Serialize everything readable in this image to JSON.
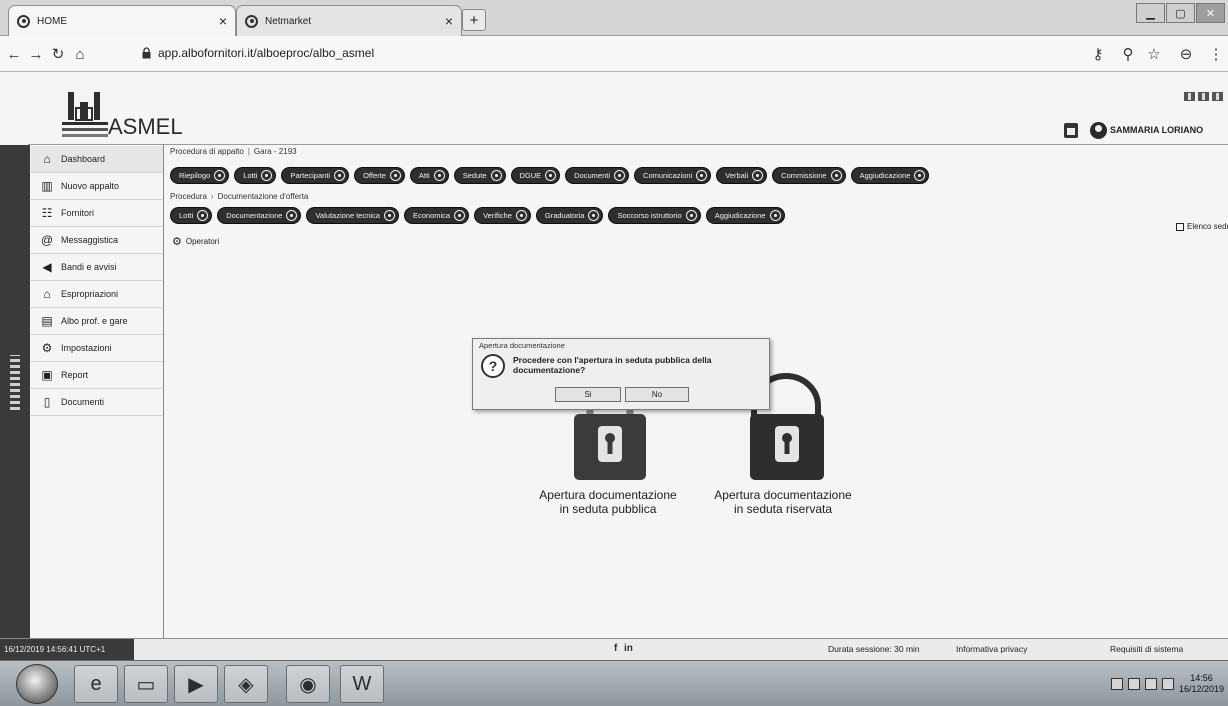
{
  "browser": {
    "tabs": [
      {
        "title": "HOME",
        "icon": "globe-icon"
      },
      {
        "title": "Netmarket",
        "icon": "netmarket-icon"
      }
    ],
    "url": "app.albofornitori.it/alboeproc/albo_asmel"
  },
  "header": {
    "logo_text": "ASMEL",
    "user_name": "SAMMARIA LORIANO"
  },
  "sidebar": {
    "items": [
      {
        "label": "Dashboard",
        "icon": "home-icon"
      },
      {
        "label": "Nuovo appalto",
        "icon": "building-icon"
      },
      {
        "label": "Fornitori",
        "icon": "users-icon"
      },
      {
        "label": "Messaggistica",
        "icon": "at-icon"
      },
      {
        "label": "Bandi e avvisi",
        "icon": "megaphone-icon"
      },
      {
        "label": "Espropriazioni",
        "icon": "house-icon"
      },
      {
        "label": "Albo prof. e gare",
        "icon": "list-icon"
      },
      {
        "label": "Impostazioni",
        "icon": "gear-icon"
      },
      {
        "label": "Report",
        "icon": "monitor-icon"
      },
      {
        "label": "Documenti",
        "icon": "file-icon"
      }
    ]
  },
  "breadcrumb": {
    "items": [
      "Procedura di appalto",
      "Gara - 2193"
    ]
  },
  "toolbar_primary": {
    "items": [
      "Riepilogo",
      "Lotti",
      "Partecipanti",
      "Offerte",
      "Atti",
      "Sedute",
      "DGUE",
      "Documenti",
      "Comunicazioni",
      "Verbali",
      "Commissione",
      "Aggiudicazione"
    ]
  },
  "breadcrumb2": {
    "items": [
      "Procedura",
      "Documentazione d'offerta"
    ]
  },
  "toolbar_secondary": {
    "items": [
      "Lotti",
      "Documentazione",
      "Valutazione tecnica",
      "Economica",
      "Verifiche",
      "Graduatoria",
      "Soccorso istruttorio",
      "Aggiudicazione"
    ]
  },
  "operatori_label": "Operatori",
  "elenco_sedute_label": "Elenco sedute",
  "locks": [
    {
      "label": "Apertura documentazione in seduta pubblica",
      "state": "closed"
    },
    {
      "label": "Apertura documentazione in seduta riservata",
      "state": "open"
    }
  ],
  "dialog": {
    "title": "Apertura documentazione",
    "message": "Procedere con l'apertura in seduta pubblica della documentazione?",
    "yes_label": "Si",
    "no_label": "No"
  },
  "footer": {
    "timestamp": "16/12/2019 14:56:41 UTC+1",
    "session": "Durata sessione: 30 min",
    "privacy": "Informativa privacy",
    "requirements": "Requisiti di sistema"
  },
  "taskbar": {
    "icons": [
      "start-orb-icon",
      "internet-explorer-icon",
      "file-explorer-icon",
      "media-player-icon",
      "app-icon",
      "chrome-icon",
      "word-icon"
    ],
    "clock_time": "14:56",
    "clock_date": "16/12/2019"
  },
  "colors": {
    "pill_bg": "#2e2e2e",
    "sidebar_strip": "#3a3a3a",
    "page_bg": "#f5f5f5",
    "dialog_bg": "#efefef"
  }
}
